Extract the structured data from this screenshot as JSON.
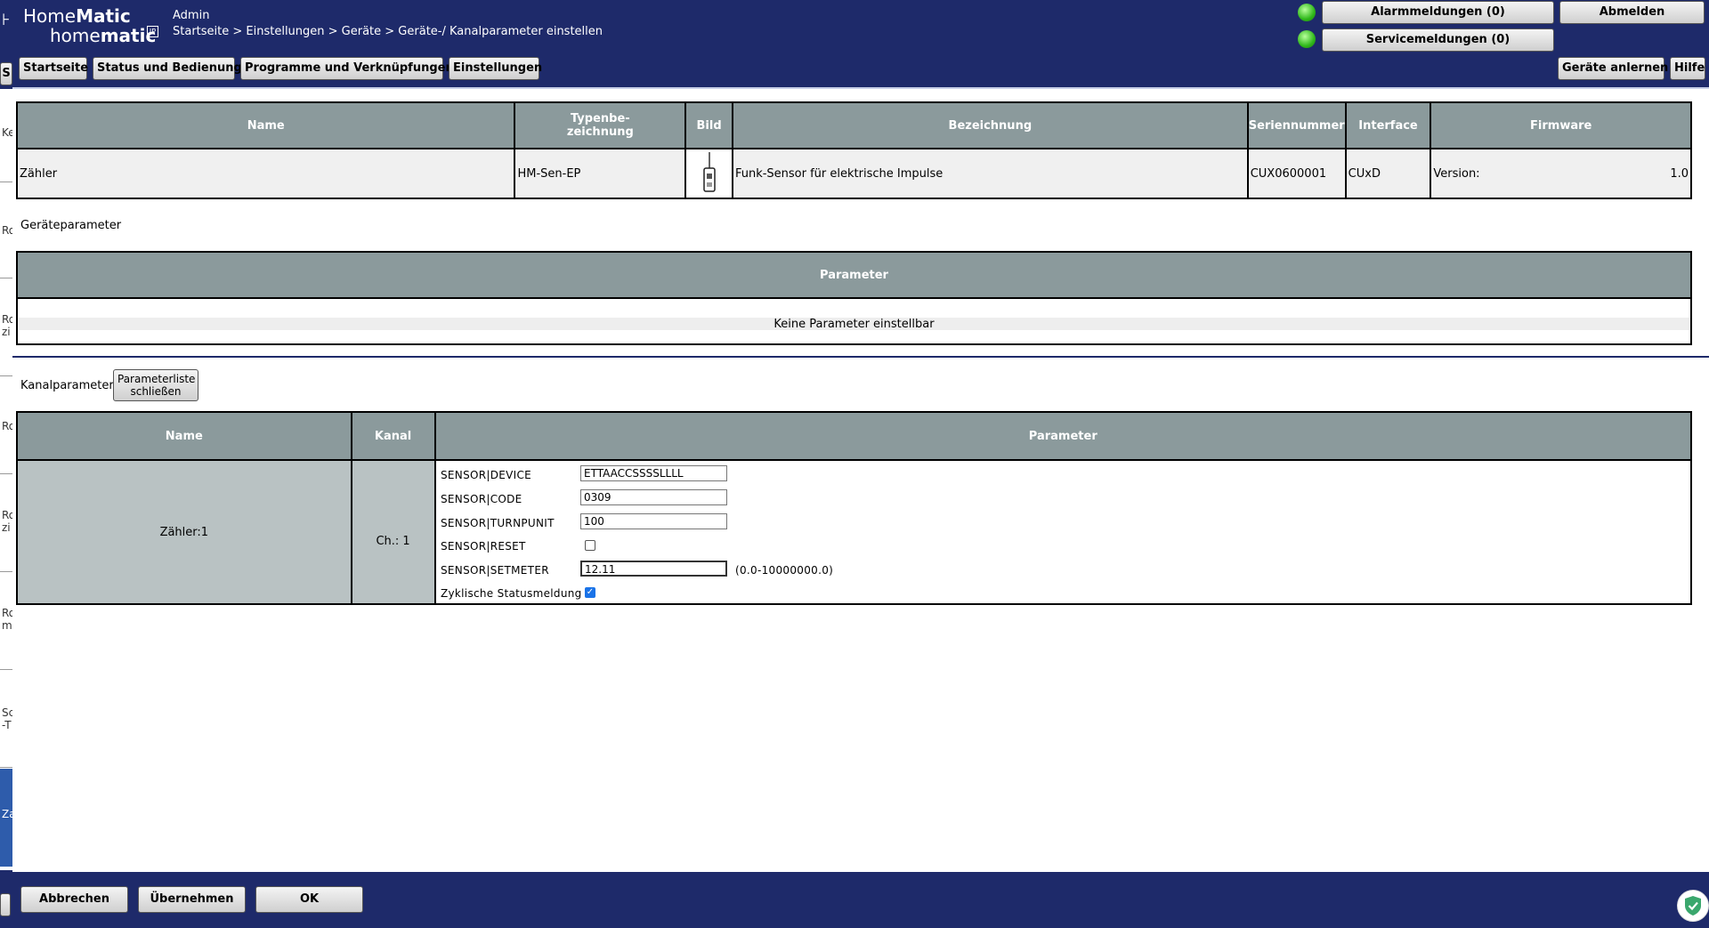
{
  "header": {
    "logo_top_regular": "Home",
    "logo_top_bold": "Matic",
    "logo_bottom_regular": "home",
    "logo_bottom_bold": "matic",
    "logo_box": "IP",
    "user": "Admin",
    "breadcrumb": "Startseite > Einstellungen > Geräte > Geräte-/ Kanalparameter einstellen",
    "alarm_label": "Alarmmeldungen (0)",
    "service_label": "Servicemeldungen (0)",
    "logout_label": "Abmelden",
    "status_led_color": "#2fb81a"
  },
  "nav": {
    "home": "Startseite",
    "status": "Status und Bedienung",
    "programs": "Programme und Verknüpfungen",
    "settings": "Einstellungen",
    "teach": "Geräte anlernen",
    "help": "Hilfe"
  },
  "device_table": {
    "headers": [
      "Name",
      "Typenbe-\nzeichnung",
      "Bild",
      "Bezeichnung",
      "Seriennummer",
      "Interface",
      "Firmware"
    ],
    "row": {
      "name": "Zähler",
      "type": "HM-Sen-EP",
      "description": "Funk-Sensor für elektrische Impulse",
      "serial": "CUX0600001",
      "interface": "CUxD",
      "firmware_label": "Version:",
      "firmware_value": "1.0"
    }
  },
  "device_params": {
    "section_label": "Geräteparameter",
    "header": "Parameter",
    "empty_text": "Keine Parameter einstellbar"
  },
  "channel_params": {
    "section_label": "Kanalparameter",
    "close_button": "Parameterliste schließen",
    "headers": [
      "Name",
      "Kanal",
      "Parameter"
    ],
    "row": {
      "name": "Zähler:1",
      "channel": "Ch.: 1"
    },
    "params": [
      {
        "label": "SENSOR|DEVICE",
        "value": "ETTAACCSSSSLLLL"
      },
      {
        "label": "SENSOR|CODE",
        "value": "0309"
      },
      {
        "label": "SENSOR|TURNPUNIT",
        "value": "100"
      },
      {
        "label": "SENSOR|RESET",
        "checked": false
      },
      {
        "label": "SENSOR|SETMETER",
        "value": "12.11",
        "range": "(0.0-10000000.0)"
      },
      {
        "label": "Zyklische Statusmeldung",
        "checked": true
      }
    ]
  },
  "sidebar_fragments": [
    "Ke",
    "Ro",
    "Ro",
    "zi",
    "Ro",
    "Ro",
    "zi",
    "Ro",
    "m",
    "Sc",
    "-T",
    "Za"
  ],
  "footer": {
    "cancel": "Abbrechen",
    "apply": "Übernehmen",
    "ok": "OK"
  },
  "icons": {
    "device_image": "sensor-device-icon",
    "shield": "shield-check-icon"
  }
}
